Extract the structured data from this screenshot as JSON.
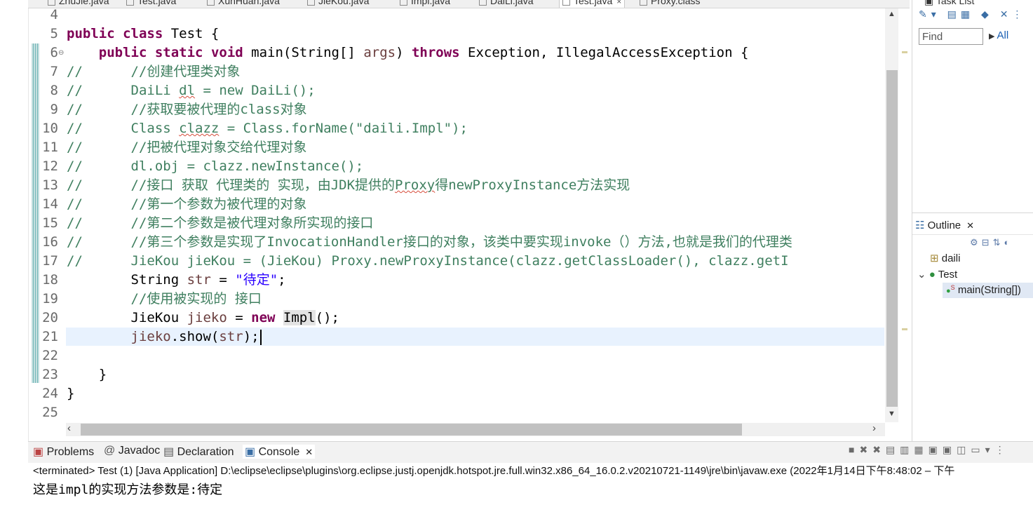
{
  "editor_tabs": [
    "ZhuJie.java",
    "Test.java",
    "XunHuan.java",
    "JieKou.java",
    "Impl.java",
    "DaiLi.java",
    "Test.java",
    "Proxy.class"
  ],
  "editor_tab_close": "×",
  "code_lines": [
    {
      "num": "4",
      "html": ""
    },
    {
      "num": "5",
      "html": "<span class=\"kw\">public</span> <span class=\"kw\">class</span> Test {"
    },
    {
      "num": "6",
      "html": "    <span class=\"kw\">public</span> <span class=\"kw\">static</span> <span class=\"kw\">void</span> main(String[] <span class=\"pa\">args</span>) <span class=\"kw\">throws</span> Exception, IllegalAccessException {"
    },
    {
      "num": "7",
      "html": "<span class=\"cm\">//      //创建代理类对象</span>"
    },
    {
      "num": "8",
      "html": "<span class=\"cm\">//      DaiLi <span class=\"sq\">dl</span> = new DaiLi();</span>"
    },
    {
      "num": "9",
      "html": "<span class=\"cm\">//      //获取要被代理的class对象</span>"
    },
    {
      "num": "10",
      "html": "<span class=\"cm\">//      Class <span class=\"sq\">clazz</span> = Class.forName(\"daili.Impl\");</span>"
    },
    {
      "num": "11",
      "html": "<span class=\"cm\">//      //把被代理对象交给代理对象</span>"
    },
    {
      "num": "12",
      "html": "<span class=\"cm\">//      dl.obj = clazz.newInstance();</span>"
    },
    {
      "num": "13",
      "html": "<span class=\"cm\">//      //接口 获取 代理类的 实现，由JDK提供的<span class=\"sq\">Proxy</span>得newProxyInstance方法实现</span>"
    },
    {
      "num": "14",
      "html": "<span class=\"cm\">//      //第一个参数为被代理的对象</span>"
    },
    {
      "num": "15",
      "html": "<span class=\"cm\">//      //第二个参数是被代理对象所实现的接口</span>"
    },
    {
      "num": "16",
      "html": "<span class=\"cm\">//      //第三个参数是实现了InvocationHandler接口的对象，该类中要实现invoke（）方法,也就是我们的代理类</span>"
    },
    {
      "num": "17",
      "html": "<span class=\"cm\">//      JieKou jieKou = (JieKou) Proxy.newProxyInstance(clazz.getClassLoader(), clazz.getI</span>"
    },
    {
      "num": "18",
      "html": "        String <span class=\"pa\">str</span> = <span class=\"st\">\"待定\"</span>;"
    },
    {
      "num": "19",
      "html": "        <span class=\"cm\">//使用被实现的 接口</span>"
    },
    {
      "num": "20",
      "html": "        JieKou <span class=\"pa\">jieko</span> = <span class=\"kw\">new</span> <span class=\"hlword\">Impl</span>();"
    },
    {
      "num": "21",
      "html": "        <span class=\"pa\">jieko</span>.show(<span class=\"pa\">str</span>);<span id=\"caret\"></span>"
    },
    {
      "num": "22",
      "html": ""
    },
    {
      "num": "23",
      "html": "    }"
    },
    {
      "num": "24",
      "html": "}"
    },
    {
      "num": "25",
      "html": ""
    }
  ],
  "task_list": {
    "title": "Task List",
    "find_placeholder": "Find",
    "all_label": "All"
  },
  "outline": {
    "title": "Outline",
    "items": [
      {
        "label": "daili"
      },
      {
        "label": "Test"
      },
      {
        "label": "main(String[])"
      }
    ]
  },
  "console_tabs": [
    {
      "label": "Problems"
    },
    {
      "label": "Javadoc"
    },
    {
      "label": "Declaration"
    },
    {
      "label": "Console"
    }
  ],
  "console": {
    "terminated": "<terminated> Test (1) [Java Application] D:\\eclipse\\eclipse\\plugins\\org.eclipse.justj.openjdk.hotspot.jre.full.win32.x86_64_16.0.2.v20210721-1149\\jre\\bin\\javaw.exe  (2022年1月14日下午8:48:02 – 下午",
    "output": "这是impl的实现方法参数是:待定"
  },
  "colors": {
    "keyword": "#7f0055",
    "comment": "#3f7f5f",
    "string": "#2a00ff",
    "current_line": "#e8f2fe"
  }
}
